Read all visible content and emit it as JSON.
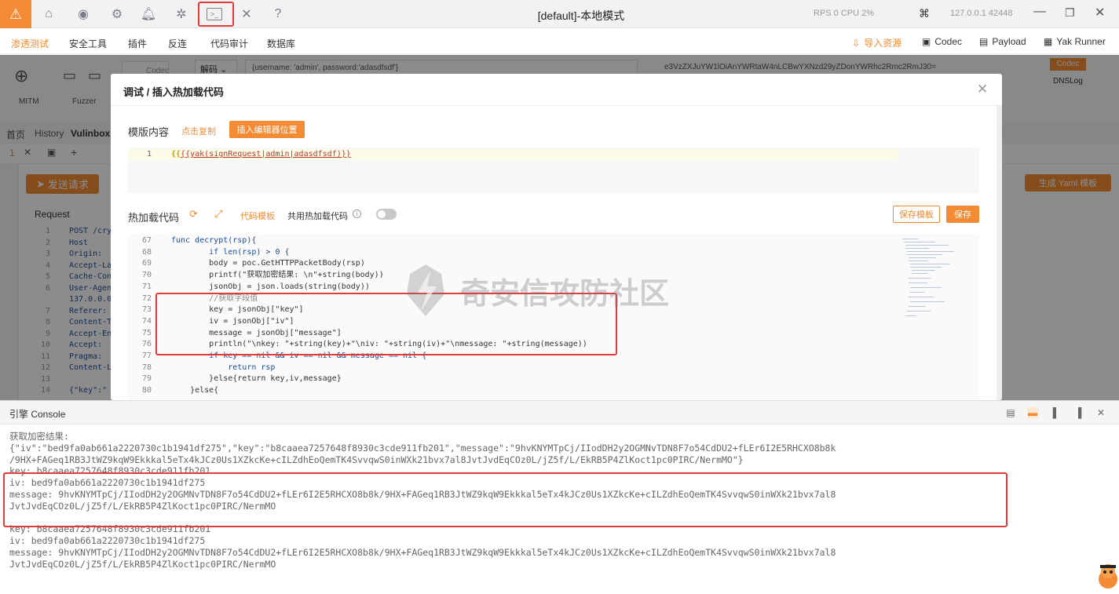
{
  "titlebar": {
    "title": "[default]-本地模式",
    "rps": "RPS 0  CPU 2%",
    "ip": "127.0.0.1 42448"
  },
  "menubar": {
    "items": [
      "渗透测试",
      "安全工具",
      "插件",
      "反连",
      "代码审计",
      "数据库"
    ],
    "right": {
      "import": "导入资源",
      "codec": "Codec",
      "payload": "Payload",
      "yak_runner": "Yak Runner"
    }
  },
  "toolbar": {
    "mitm": "MITM",
    "fuzzer": "Fuzzer",
    "codec_tab": "Codec",
    "decode_select": "解码",
    "decode_input": "{username: 'admin', password:'adasdfsdf'}",
    "decode_output": "e3VzZXJuYW1lOiAnYWRtaW4nLCBwYXNzd29yZDonYWRhc2Rmc2RmJ30=",
    "codec_badge": "Codec",
    "dnslog": "DNSLog"
  },
  "tabs": {
    "home": "首页",
    "history": "History",
    "vulinbox": "Vulinbox 1"
  },
  "request": {
    "send_button": "发送请求",
    "label": "Request",
    "yaml_button": "生成 Yaml 模板",
    "lines": [
      {
        "n": "1",
        "t": "POST /cry"
      },
      {
        "n": "2",
        "t": "Host"
      },
      {
        "n": "3",
        "t": "Origin:"
      },
      {
        "n": "4",
        "t": "Accept-La"
      },
      {
        "n": "5",
        "t": "Cache-Con"
      },
      {
        "n": "6",
        "t": "User-Agen"
      },
      {
        "n": "",
        "t": "137.0.0.0"
      },
      {
        "n": "7",
        "t": "Referer:"
      },
      {
        "n": "8",
        "t": "Content-T"
      },
      {
        "n": "9",
        "t": "Accept-En"
      },
      {
        "n": "10",
        "t": "Accept:"
      },
      {
        "n": "11",
        "t": "Pragma:"
      },
      {
        "n": "12",
        "t": "Content-L"
      },
      {
        "n": "13",
        "t": ""
      },
      {
        "n": "14",
        "t": "{\"key\":\""
      }
    ]
  },
  "modal": {
    "title": "调试 / 插入热加载代码",
    "template_label": "模版内容",
    "copy_link": "点击复制",
    "insert_button": "插入编辑器位置",
    "template_line_number": "1",
    "template_code": "{{yak(signRequest|admin|adasdfsdf)}}",
    "hot_label": "热加载代码",
    "code_template_link": "代码模板",
    "shared_label": "共用热加载代码",
    "save_template_button": "保存模板",
    "save_button": "保存",
    "code_lines": [
      {
        "n": "67",
        "c": "func decrypt(rsp){"
      },
      {
        "n": "68",
        "c": "        if len(rsp) > 0 {"
      },
      {
        "n": "69",
        "c": "        body = poc.GetHTTPPacketBody(rsp)"
      },
      {
        "n": "70",
        "c": "        printf(\"获取加密结果: \\n\"+string(body))"
      },
      {
        "n": "71",
        "c": "        jsonObj = json.loads(string(body))"
      },
      {
        "n": "72",
        "c": "        //获取字段值"
      },
      {
        "n": "73",
        "c": "        key = jsonObj[\"key\"]"
      },
      {
        "n": "74",
        "c": "        iv = jsonObj[\"iv\"]"
      },
      {
        "n": "75",
        "c": "        message = jsonObj[\"message\"]"
      },
      {
        "n": "76",
        "c": "        println(\"\\nkey: \"+string(key)+\"\\niv: \"+string(iv)+\"\\nmessage: \"+string(message))"
      },
      {
        "n": "77",
        "c": "        if key == nil && iv == nil && message == nil {"
      },
      {
        "n": "78",
        "c": "            return rsp"
      },
      {
        "n": "79",
        "c": "        }else{return key,iv,message}"
      },
      {
        "n": "80",
        "c": "    }else{"
      }
    ],
    "watermark": "奇安信攻防社区"
  },
  "console": {
    "title": "引擎 Console",
    "lines": [
      "获取加密结果:",
      "{\"iv\":\"bed9fa0ab661a2220730c1b1941df275\",\"key\":\"b8caaea7257648f8930c3cde911fb201\",\"message\":\"9hvKNYMTpCj/IIodDH2y2OGMNvTDN8F7o54CdDU2+fLEr6I2E5RHCXO8b8k",
      "/9HX+FAGeq1RB3JtWZ9kqW9Ekkkal5eTx4kJCz0Us1XZkcKe+cILZdhEoQemTK4SvvqwS0inWXk21bvx7al8JvtJvdEqCOz0L/jZ5f/L/EkRB5P4ZlKoct1pc0PIRC/NermMO\"}",
      "key: b8caaea7257648f8930c3cde911fb201",
      "iv: bed9fa0ab661a2220730c1b1941df275",
      "message: 9hvKNYMTpCj/IIodDH2y2OGMNvTDN8F7o54CdDU2+fLEr6I2E5RHCXO8b8k/9HX+FAGeq1RB3JtWZ9kqW9Ekkkal5eTx4kJCz0Us1XZkcKe+cILZdhEoQemTK4SvvqwS0inWXk21bvx7al8",
      "JvtJvdEqCOz0L/jZ5f/L/EkRB5P4ZlKoct1pc0PIRC/NermMO",
      "",
      "key: b8caaea7257648f8930c3cde911fb201",
      "iv: bed9fa0ab661a2220730c1b1941df275",
      "message: 9hvKNYMTpCj/IIodDH2y2OGMNvTDN8F7o54CdDU2+fLEr6I2E5RHCXO8b8k/9HX+FAGeq1RB3JtWZ9kqW9Ekkkal5eTx4kJCz0Us1XZkcKe+cILZdhEoQemTK4SvvqwS0inWXk21bvx7al8",
      "JvtJvdEqCOz0L/jZ5f/L/EkRB5P4ZlKoct1pc0PIRC/NermMO"
    ]
  },
  "colors": {
    "accent": "#f28b34",
    "highlight": "#e23b3b"
  }
}
